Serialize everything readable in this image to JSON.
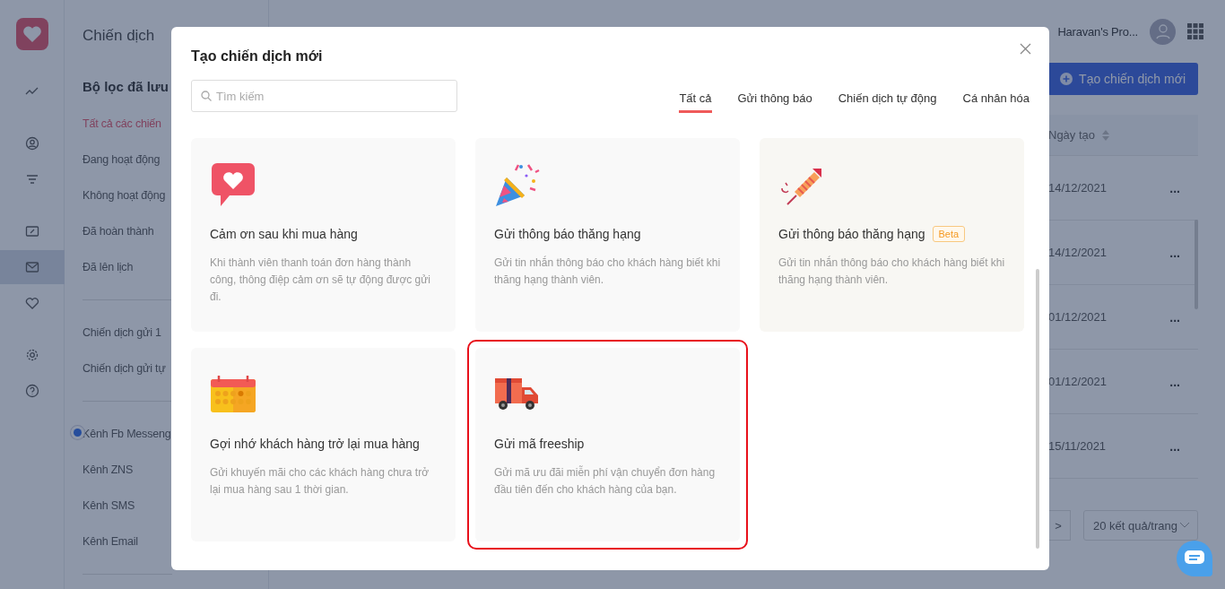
{
  "rail": {
    "items": [
      {
        "kind": "chart",
        "selected": false
      },
      {
        "kind": "user",
        "selected": false
      },
      {
        "kind": "filter",
        "selected": false
      },
      {
        "kind": "ticket",
        "selected": false
      },
      {
        "kind": "mail",
        "selected": true
      },
      {
        "kind": "heart",
        "selected": false
      },
      {
        "kind": "gear",
        "selected": false
      },
      {
        "kind": "help",
        "selected": false
      }
    ]
  },
  "sidebar": {
    "title": "Chiến dịch",
    "saved_filters_heading": "Bộ lọc đã lưu",
    "groups": [
      [
        {
          "label": "Tất cả các chiến",
          "selected": true
        },
        {
          "label": "Đang hoạt động",
          "selected": false
        },
        {
          "label": "Không hoạt động",
          "selected": false
        },
        {
          "label": "Đã hoàn thành",
          "selected": false
        },
        {
          "label": "Đã lên lịch",
          "selected": false
        }
      ],
      [
        {
          "label": "Chiến dịch gửi 1",
          "selected": false
        },
        {
          "label": "Chiến dịch gửi tự",
          "selected": false
        }
      ],
      [
        {
          "label": "Kênh Fb Messeng",
          "selected": false
        },
        {
          "label": "Kênh ZNS",
          "selected": false
        },
        {
          "label": "Kênh SMS",
          "selected": false
        },
        {
          "label": "Kênh Email",
          "selected": false
        }
      ]
    ]
  },
  "header": {
    "user_name": "Haravan's Pro..."
  },
  "create_button": "Tạo chiến dịch mới",
  "table": {
    "columns": [
      "Ngày tạo"
    ],
    "rows": [
      {
        "date": "14/12/2021",
        "menu": "..."
      },
      {
        "date": "14/12/2021",
        "menu": "..."
      },
      {
        "date": "01/12/2021",
        "menu": "..."
      },
      {
        "date": "01/12/2021",
        "menu": "..."
      },
      {
        "date": "15/11/2021",
        "menu": "..."
      }
    ]
  },
  "pagination": {
    "next": ">",
    "page_size": "20 kết quả/trang"
  },
  "modal": {
    "title": "Tạo chiến dịch mới",
    "search": {
      "placeholder": "Tìm kiếm"
    },
    "tabs": [
      {
        "label": "Tất cả",
        "selected": true
      },
      {
        "label": "Gửi thông báo",
        "selected": false
      },
      {
        "label": "Chiến dịch tự động",
        "selected": false
      },
      {
        "label": "Cá nhân hóa",
        "selected": false
      }
    ],
    "cards": [
      {
        "kind": "heart",
        "title": "Cảm ơn sau khi mua hàng",
        "description": "Khi thành viên thanh toán đơn hàng thành công, thông điệp cảm ơn sẽ tự động được gửi đi.",
        "highlighted": false
      },
      {
        "kind": "party",
        "title": "Gửi thông báo thăng hạng",
        "description": "Gửi tin nhắn thông báo cho khách hàng biết khi thăng hạng thành viên.",
        "highlighted": false
      },
      {
        "kind": "rocket",
        "title": "Gửi thông báo thăng hạng",
        "badge": "Beta",
        "description": "Gửi tin nhắn thông báo cho khách hàng biết khi thăng hạng thành viên.",
        "highlighted": false
      },
      {
        "kind": "calendar",
        "title": "Gợi nhớ khách hàng trở lại mua hàng",
        "description": "Gửi khuyến mãi cho các khách hàng chưa trở lại mua hàng sau 1 thời gian.",
        "highlighted": false
      },
      {
        "kind": "truck",
        "title": "Gửi mã freeship",
        "description": "Gửi mã ưu đãi miễn phí vận chuyển đơn hàng đầu tiên đến cho khách hàng của bạn.",
        "highlighted": true
      }
    ]
  }
}
